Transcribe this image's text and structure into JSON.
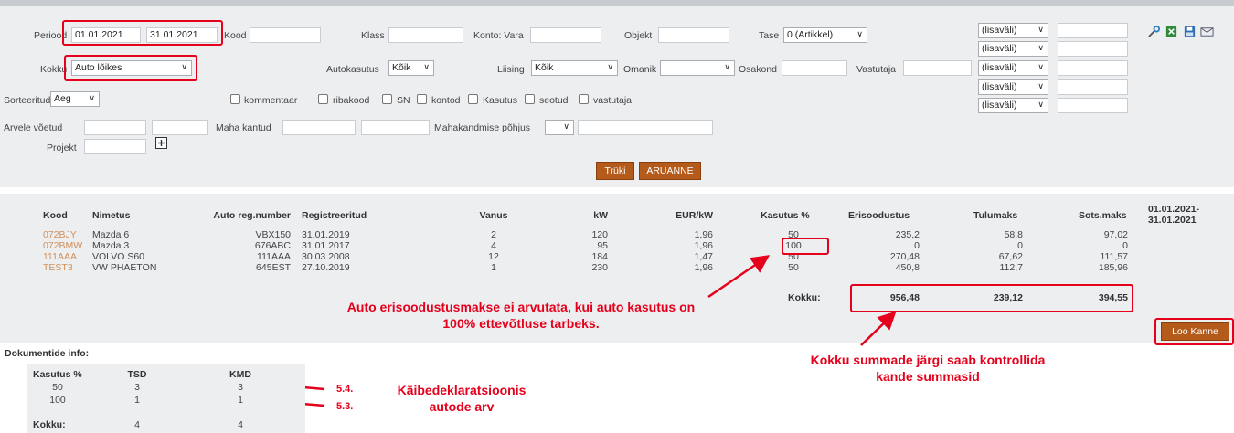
{
  "filters": {
    "periood_label": "Periood",
    "periood_from": "01.01.2021",
    "periood_to": "31.01.2021",
    "kood_label": "Kood",
    "klass_label": "Klass",
    "konto_label": "Konto: Vara",
    "objekt_label": "Objekt",
    "tase_label": "Tase",
    "tase_value": "0 (Artikkel)",
    "kokku_label": "Kokku",
    "kokku_value": "Auto lõikes",
    "autokasutus_label": "Autokasutus",
    "autokasutus_value": "Kõik",
    "liising_label": "Liising",
    "liising_value": "Kõik",
    "omanik_label": "Omanik",
    "osakond_label": "Osakond",
    "vastutaja_label": "Vastutaja",
    "sorteeritud_label": "Sorteeritud",
    "sorteeritud_value": "Aeg",
    "arvele_label": "Arvele võetud",
    "maha_label": "Maha kantud",
    "mahakandmise_label": "Mahakandmise põhjus",
    "projekt_label": "Projekt",
    "extra_selects": [
      "(lisaväli)",
      "(lisaväli)",
      "(lisaväli)",
      "(lisaväli)",
      "(lisaväli)"
    ],
    "checkboxes": [
      "kommentaar",
      "ribakood",
      "SN",
      "kontod",
      "Kasutus",
      "seotud",
      "vastutaja"
    ]
  },
  "buttons": {
    "print": "Trüki",
    "report": "ARUANNE",
    "create_entry": "Loo Kanne"
  },
  "table": {
    "headers": [
      "Kood",
      "Nimetus",
      "Auto reg.number",
      "Registreeritud",
      "Vanus",
      "kW",
      "EUR/kW",
      "Kasutus %",
      "Erisoodustus",
      "Tulumaks",
      "Sots.maks",
      "01.01.2021-\n31.01.2021"
    ],
    "rows": [
      [
        "072BJY",
        "Mazda 6",
        "VBX150",
        "31.01.2019",
        "2",
        "120",
        "1,96",
        "50",
        "235,2",
        "58,8",
        "97,02"
      ],
      [
        "072BMW",
        "Mazda 3",
        "676ABC",
        "31.01.2017",
        "4",
        "95",
        "1,96",
        "100",
        "0",
        "0",
        "0"
      ],
      [
        "111AAA",
        "VOLVO S60",
        "111AAA",
        "30.03.2008",
        "12",
        "184",
        "1,47",
        "50",
        "270,48",
        "67,62",
        "111,57"
      ],
      [
        "TEST3",
        "VW PHAETON",
        "645EST",
        "27.10.2019",
        "1",
        "230",
        "1,96",
        "50",
        "450,8",
        "112,7",
        "185,96"
      ]
    ],
    "total_label": "Kokku:",
    "totals": [
      "956,48",
      "239,12",
      "394,55"
    ]
  },
  "annotations": {
    "note1": "Auto erisoodustusmakse ei arvutata, kui auto kasutus on\n100% ettevõtluse tarbeks.",
    "note2": "Kokku summade järgi saab kontrollida\nkande summasid",
    "note3": "Käibedeklaratsioonis\nautode arv",
    "ref1": "5.4.",
    "ref2": "5.3."
  },
  "docinfo": {
    "title": "Dokumentide info:",
    "headers": [
      "Kasutus %",
      "TSD",
      "KMD"
    ],
    "rows": [
      [
        "50",
        "3",
        "3"
      ],
      [
        "100",
        "1",
        "1"
      ]
    ],
    "total_label": "Kokku:",
    "totals": [
      "4",
      "4"
    ]
  },
  "colors": {
    "accent_red": "#e5001c",
    "button_brown": "#b45a1a",
    "link_orange": "#d2915a"
  },
  "icons": [
    "tools-icon",
    "excel-icon",
    "save-icon",
    "email-icon",
    "plus-icon"
  ]
}
